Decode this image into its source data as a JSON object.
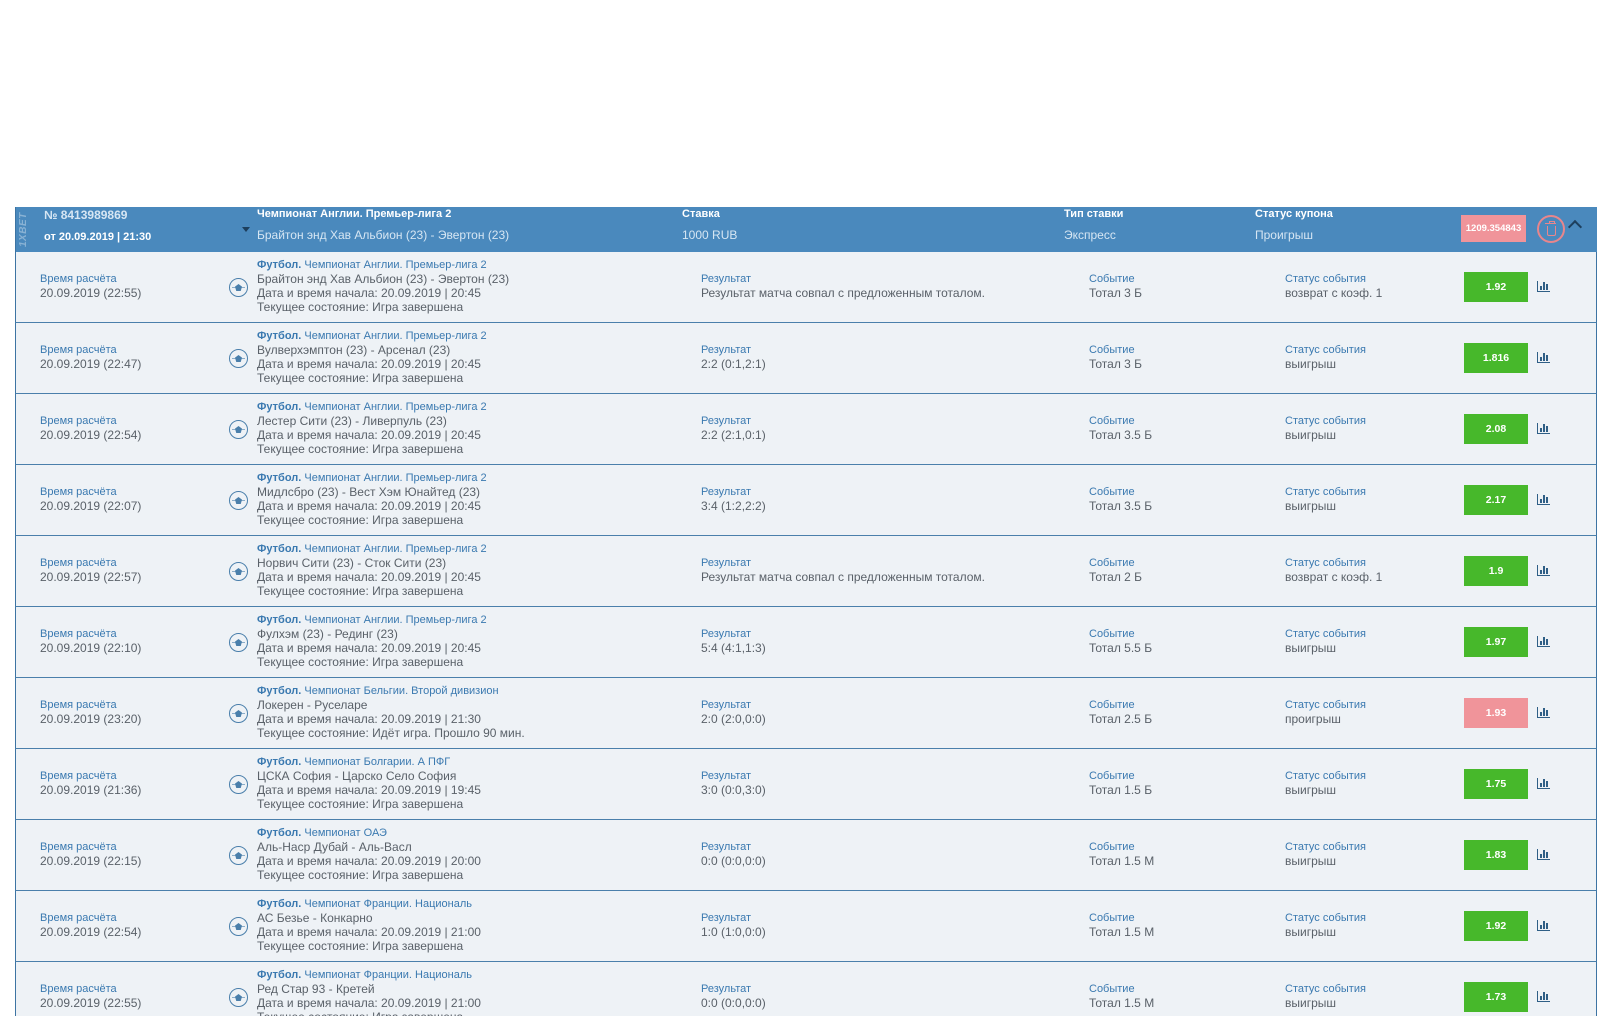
{
  "coupon": {
    "logo_text": "1XBET",
    "number": "№ 8413989869",
    "date": "от 20.09.2019 | 21:30",
    "championship": "Чемпионат Англии. Премьер-лига 2",
    "match": "Брайтон энд Хав Альбион (23) - Эвертон (23)",
    "stake_label": "Ставка",
    "stake_value": "1000 RUB",
    "bet_type_label": "Тип ставки",
    "bet_type_value": "Экспресс",
    "status_label": "Статус купона",
    "status_value": "Проигрыш",
    "sum_badge": "1209.354843",
    "delete_icon": "trash-icon",
    "collapse_icon": "chevron-up-icon"
  },
  "labels": {
    "calc_time": "Время расчёта",
    "result": "Результат",
    "event": "Событие",
    "event_status": "Статус события"
  },
  "colors": {
    "header_bg": "#4a89bd",
    "win": "#47b82b",
    "lose": "#f0949a"
  },
  "rows": [
    {
      "calc_time": "20.09.2019 (22:55)",
      "sport": "Футбол.",
      "league": "Чемпионат Англии. Премьер-лига 2",
      "match": "Брайтон энд Хав Альбион (23) - Эвертон (23)",
      "start": "Дата и время начала: 20.09.2019 | 20:45",
      "state": "Текущее состояние: Игра завершена",
      "result": "Результат матча совпал с предложенным тоталом.",
      "event": "Тотал 3 Б",
      "status": "возврат с коэф. 1",
      "coef": "1.92",
      "coef_state": "win"
    },
    {
      "calc_time": "20.09.2019 (22:47)",
      "sport": "Футбол.",
      "league": "Чемпионат Англии. Премьер-лига 2",
      "match": "Вулверхэмптон (23) - Арсенал (23)",
      "start": "Дата и время начала: 20.09.2019 | 20:45",
      "state": "Текущее состояние: Игра завершена",
      "result": "2:2 (0:1,2:1)",
      "event": "Тотал 3 Б",
      "status": "выигрыш",
      "coef": "1.816",
      "coef_state": "win"
    },
    {
      "calc_time": "20.09.2019 (22:54)",
      "sport": "Футбол.",
      "league": "Чемпионат Англии. Премьер-лига 2",
      "match": "Лестер Сити (23) - Ливерпуль (23)",
      "start": "Дата и время начала: 20.09.2019 | 20:45",
      "state": "Текущее состояние: Игра завершена",
      "result": "2:2 (2:1,0:1)",
      "event": "Тотал 3.5 Б",
      "status": "выигрыш",
      "coef": "2.08",
      "coef_state": "win"
    },
    {
      "calc_time": "20.09.2019 (22:07)",
      "sport": "Футбол.",
      "league": "Чемпионат Англии. Премьер-лига 2",
      "match": "Мидлсбро (23) - Вест Хэм Юнайтед (23)",
      "start": "Дата и время начала: 20.09.2019 | 20:45",
      "state": "Текущее состояние: Игра завершена",
      "result": "3:4 (1:2,2:2)",
      "event": "Тотал 3.5 Б",
      "status": "выигрыш",
      "coef": "2.17",
      "coef_state": "win"
    },
    {
      "calc_time": "20.09.2019 (22:57)",
      "sport": "Футбол.",
      "league": "Чемпионат Англии. Премьер-лига 2",
      "match": "Норвич Сити (23) - Сток Сити (23)",
      "start": "Дата и время начала: 20.09.2019 | 20:45",
      "state": "Текущее состояние: Игра завершена",
      "result": "Результат матча совпал с предложенным тоталом.",
      "event": "Тотал 2 Б",
      "status": "возврат с коэф. 1",
      "coef": "1.9",
      "coef_state": "win"
    },
    {
      "calc_time": "20.09.2019 (22:10)",
      "sport": "Футбол.",
      "league": "Чемпионат Англии. Премьер-лига 2",
      "match": "Фулхэм (23) - Рединг (23)",
      "start": "Дата и время начала: 20.09.2019 | 20:45",
      "state": "Текущее состояние: Игра завершена",
      "result": "5:4 (4:1,1:3)",
      "event": "Тотал 5.5 Б",
      "status": "выигрыш",
      "coef": "1.97",
      "coef_state": "win"
    },
    {
      "calc_time": "20.09.2019 (23:20)",
      "sport": "Футбол.",
      "league": "Чемпионат Бельгии. Второй дивизион",
      "match": "Локерен - Руселаре",
      "start": "Дата и время начала: 20.09.2019 | 21:30",
      "state": "Текущее состояние: Идёт игра. Прошло 90 мин.",
      "result": "2:0 (2:0,0:0)",
      "event": "Тотал 2.5 Б",
      "status": "проигрыш",
      "coef": "1.93",
      "coef_state": "lose"
    },
    {
      "calc_time": "20.09.2019 (21:36)",
      "sport": "Футбол.",
      "league": "Чемпионат Болгарии. А ПФГ",
      "match": "ЦСКА София - Царско Село София",
      "start": "Дата и время начала: 20.09.2019 | 19:45",
      "state": "Текущее состояние: Игра завершена",
      "result": "3:0 (0:0,3:0)",
      "event": "Тотал 1.5 Б",
      "status": "выигрыш",
      "coef": "1.75",
      "coef_state": "win"
    },
    {
      "calc_time": "20.09.2019 (22:15)",
      "sport": "Футбол.",
      "league": "Чемпионат ОАЭ",
      "match": "Аль-Наср Дубай - Аль-Васл",
      "start": "Дата и время начала: 20.09.2019 | 20:00",
      "state": "Текущее состояние: Игра завершена",
      "result": "0:0 (0:0,0:0)",
      "event": "Тотал 1.5 М",
      "status": "выигрыш",
      "coef": "1.83",
      "coef_state": "win"
    },
    {
      "calc_time": "20.09.2019 (22:54)",
      "sport": "Футбол.",
      "league": "Чемпионат Франции. Националь",
      "match": "АС Безье - Конкарно",
      "start": "Дата и время начала: 20.09.2019 | 21:00",
      "state": "Текущее состояние: Игра завершена",
      "result": "1:0 (1:0,0:0)",
      "event": "Тотал 1.5 М",
      "status": "выигрыш",
      "coef": "1.92",
      "coef_state": "win"
    },
    {
      "calc_time": "20.09.2019 (22:55)",
      "sport": "Футбол.",
      "league": "Чемпионат Франции. Националь",
      "match": "Ред Стар 93 - Кретей",
      "start": "Дата и время начала: 20.09.2019 | 21:00",
      "state": "Текущее состояние: Игра завершена",
      "result": "0:0 (0:0,0:0)",
      "event": "Тотал 1.5 М",
      "status": "выигрыш",
      "coef": "1.73",
      "coef_state": "win"
    }
  ]
}
